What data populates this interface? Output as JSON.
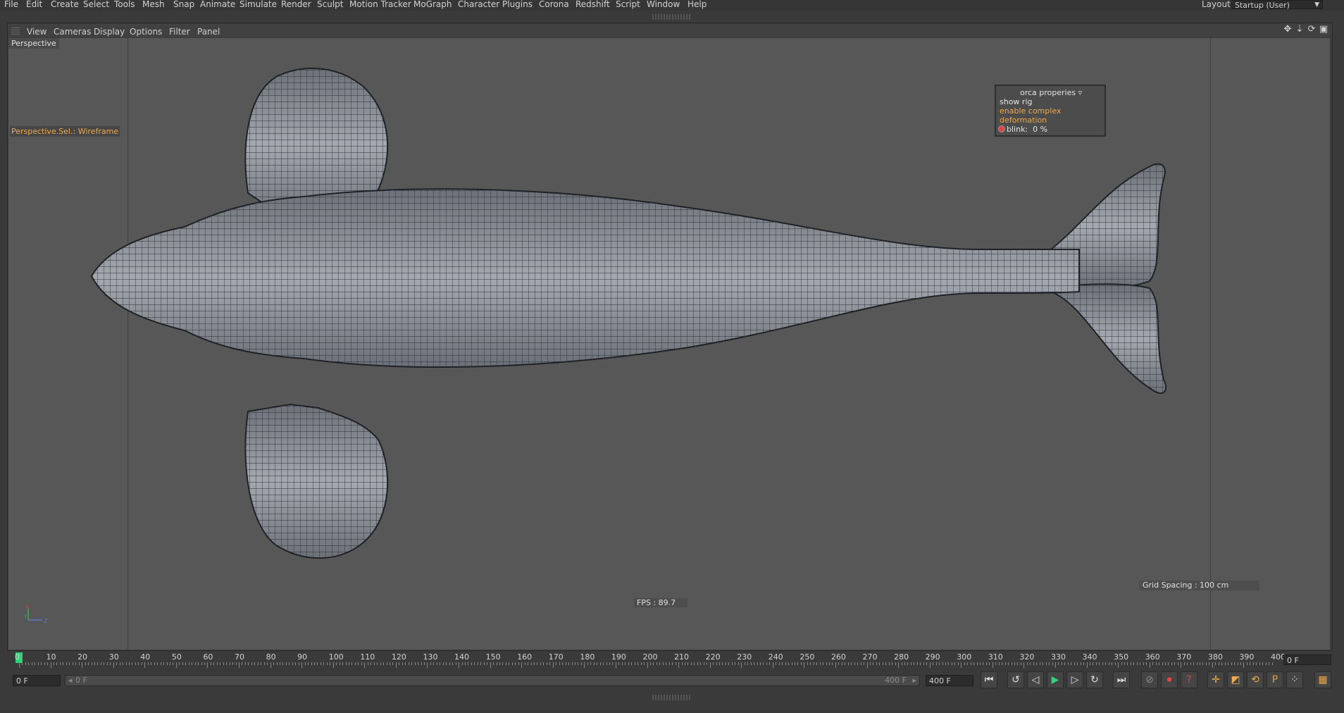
{
  "menu": [
    "File",
    "Edit",
    "Create",
    "Select",
    "Tools",
    "Mesh",
    "Snap",
    "Animate",
    "Simulate",
    "Render",
    "Sculpt",
    "Motion Tracker",
    "MoGraph",
    "Character",
    "Plugins",
    "Corona",
    "Redshift",
    "Script",
    "Window",
    "Help"
  ],
  "layout": {
    "label": "Layout:",
    "value": "Startup (User)"
  },
  "viewport_menu": [
    "View",
    "Cameras",
    "Display",
    "Options",
    "Filter",
    "Panel"
  ],
  "viewport": {
    "name": "Perspective",
    "selection_label": "Perspective.Sel.: Wireframe",
    "fps": "FPS : 89.7",
    "grid_spacing": "Grid Spacing : 100 cm",
    "axes": {
      "x": "X",
      "y": "Y",
      "z": "Z"
    }
  },
  "orca_properties": {
    "title": "orca properies",
    "show_rig": "show rig",
    "enable_complex_deformation": "enable complex deformation",
    "blink_label": "blink:",
    "blink_value": "0 %"
  },
  "timeline": {
    "ticks": [
      "0",
      "10",
      "20",
      "30",
      "40",
      "50",
      "60",
      "70",
      "80",
      "90",
      "100",
      "110",
      "120",
      "130",
      "140",
      "150",
      "160",
      "170",
      "180",
      "190",
      "200",
      "210",
      "220",
      "230",
      "240",
      "250",
      "260",
      "270",
      "280",
      "290",
      "300",
      "310",
      "320",
      "330",
      "340",
      "350",
      "360",
      "370",
      "380",
      "390",
      "400"
    ],
    "current_frame": "0 F"
  },
  "controls": {
    "start_field": "0 F",
    "range_start": "0 F",
    "range_end": "400 F",
    "end_field": "400 F"
  },
  "colors": {
    "accent_orange": "#f0a94a",
    "timeline_cursor": "#33d17a",
    "record_red": "#e04444",
    "viewport_bg": "#575757"
  }
}
